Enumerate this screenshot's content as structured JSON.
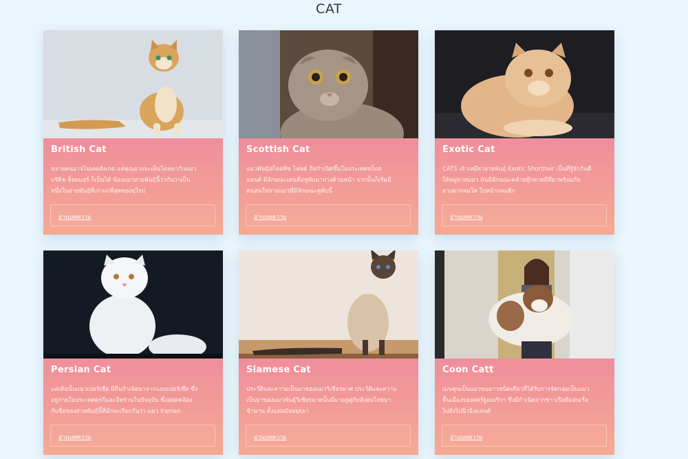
{
  "header": {
    "title": "CAT"
  },
  "cards": [
    {
      "title": "British Cat",
      "description": "หลายคนอาจไม่เคยสังเกต แต่คุณอาจจะเห็นโดยมากับแมว\nบริติช ช็อตแฮร์ ก็เป็นได้ น้องแมวสายพันธุ์นี้ว่ากันว่าเป็น\nหนึ่งในสายพันธุ์ที่เก่าแก่ที่สุดของยุโรป",
      "button": "อ่านบทความ"
    },
    {
      "title": "Scottish Cat",
      "description": "แมวพันธุ์สก็อตทิช โฟลด์ ถือกำเนิดขึ้นในประเทศสก็อต\nแลนด์ มีลักษณะเด่นคือหูพับมาทางด้านหน้า จากนั้นก็เริ่มมี\nคนสนใจขายแมวที่มีลักษณะหูพับนี้",
      "button": "อ่านบทความ"
    },
    {
      "title": "Exotic Cat",
      "description": "CATS เจ้าเหมียวสายพันธุ์ Exotic Shorthair เป็นที่รู้จักกันดี\nให้หมู่ทาสแมว มันมีลักษณะคล้ายตุ๊กตาหมีที่มาพร้อมกับ\nดวงตากลมโต ใบหน้ากลมดิก",
      "button": "อ่านบทความ"
    },
    {
      "title": "Persian Cat",
      "description": "แต่เดิมนั้นแมวเปอร์เซีย มีถิ่นกำเนิดมาจากแถบเปอร์เซีย ซึ่ง\nอยู่ภายในประเทศตุรกีและอิหร่านในปัจจุบัน ซึ่งสอดคล้อง\nกับชื่อของสายพันธุ์นี้ที่มักจะเรียกกันว่า แมว Iranian",
      "button": "อ่านบทความ"
    },
    {
      "title": "Siamese Cat",
      "description": "ประวัติและความเป็นมาของแมววิเชียรมาศ ประวัติและความ\nเป็นมาของแมวพันธุ์วิเชียรมาศนั้นมีมาอยู่คู่กับสังคมไทยมา\nช้านาน ตั้งแต่สมัยอยุธยา",
      "button": "อ่านบทความ"
    },
    {
      "title": "Coon Catt",
      "description": "เมนคูนเป็นแมวขนยาวชนิดเดียวที่ได้รับการจัดกลุ่มเป็นแมว\nพื้นเมืองของสหรัฐอเมริกา ซึ่งมีกำเนิดจากชาวเรือที่แล่นเรือ\nไปยังไปนิวอิงแลนด์",
      "button": "อ่านบทความ"
    }
  ]
}
